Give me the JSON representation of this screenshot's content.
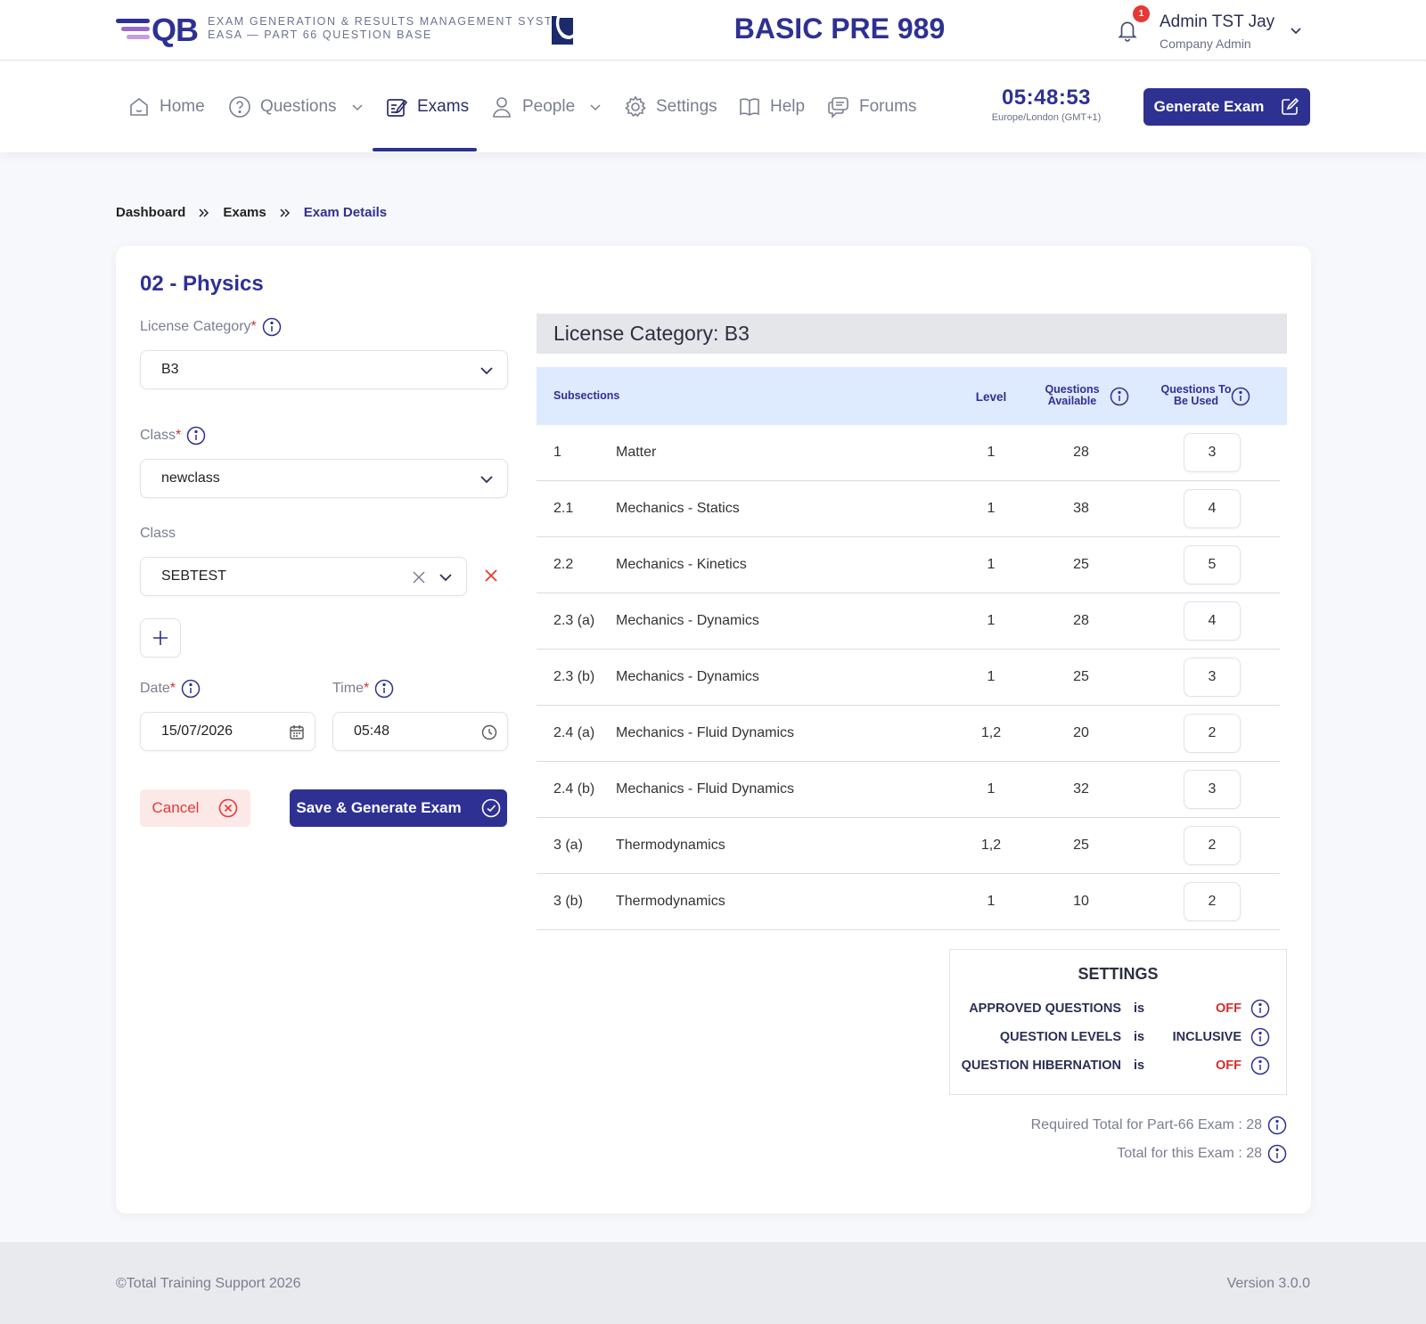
{
  "header": {
    "system_line1": "Exam Generation & Results Management System",
    "system_line2": "EASA — Part 66 Question Base",
    "logo_text": "QB",
    "app_title": "BASIC PRE 989",
    "notifications_count": "1",
    "user_name": "Admin TST Jay",
    "user_role": "Company Admin"
  },
  "nav": {
    "items": [
      {
        "label": "Home",
        "icon": "home-icon"
      },
      {
        "label": "Questions",
        "icon": "question-circle-icon"
      },
      {
        "label": "Exams",
        "icon": "edit-note-icon"
      },
      {
        "label": "People",
        "icon": "person-icon"
      },
      {
        "label": "Settings",
        "icon": "gear-icon"
      },
      {
        "label": "Help",
        "icon": "book-icon"
      },
      {
        "label": "Forums",
        "icon": "chat-icon"
      }
    ],
    "active": "Exams",
    "clock_time": "05:48:53",
    "clock_tz": "Europe/London (GMT+1)",
    "generate_label": "Generate Exam"
  },
  "breadcrumb": [
    "Dashboard",
    "Exams",
    "Exam Details"
  ],
  "form": {
    "title": "02 - Physics",
    "license_label": "License Category",
    "license_value": "B3",
    "class_label_required": "Class",
    "class_value": "newclass",
    "class_label": "Class",
    "class2_value": "SEBTEST",
    "date_label": "Date",
    "date_value": "15/07/2026",
    "time_label": "Time",
    "time_value": "05:48",
    "required_mark": "*",
    "cancel_label": "Cancel",
    "save_label": "Save & Generate Exam"
  },
  "table": {
    "category_header": "License Category: B3",
    "col_subsections": "Subsections",
    "col_level": "Level",
    "col_available": "Questions Available",
    "col_used": "Questions To Be Used",
    "rows": [
      {
        "num": "1",
        "name": "Matter",
        "level": "1",
        "available": "28",
        "used": "3"
      },
      {
        "num": "2.1",
        "name": "Mechanics - Statics",
        "level": "1",
        "available": "38",
        "used": "4"
      },
      {
        "num": "2.2",
        "name": "Mechanics - Kinetics",
        "level": "1",
        "available": "25",
        "used": "5"
      },
      {
        "num": "2.3 (a)",
        "name": "Mechanics - Dynamics",
        "level": "1",
        "available": "28",
        "used": "4"
      },
      {
        "num": "2.3 (b)",
        "name": "Mechanics - Dynamics",
        "level": "1",
        "available": "25",
        "used": "3"
      },
      {
        "num": "2.4 (a)",
        "name": "Mechanics - Fluid Dynamics",
        "level": "1,2",
        "available": "20",
        "used": "2"
      },
      {
        "num": "2.4 (b)",
        "name": "Mechanics - Fluid Dynamics",
        "level": "1",
        "available": "32",
        "used": "3"
      },
      {
        "num": "3 (a)",
        "name": "Thermodynamics",
        "level": "1,2",
        "available": "25",
        "used": "2"
      },
      {
        "num": "3 (b)",
        "name": "Thermodynamics",
        "level": "1",
        "available": "10",
        "used": "2"
      }
    ]
  },
  "settings": {
    "title": "SETTINGS",
    "rows": [
      {
        "key": "APPROVED QUESTIONS",
        "is": "is",
        "value": "OFF",
        "status_color": "#d32f2f"
      },
      {
        "key": "QUESTION LEVELS",
        "is": "is",
        "value": "INCLUSIVE",
        "status_color": "#2b2f55"
      },
      {
        "key": "QUESTION HIBERNATION",
        "is": "is",
        "value": "OFF",
        "status_color": "#d32f2f"
      }
    ]
  },
  "totals": {
    "required": "Required Total for Part-66 Exam : 28",
    "this_exam": "Total for this Exam : 28"
  },
  "footer": {
    "copyright": "©Total Training Support 2026",
    "version": "Version 3.0.0"
  },
  "colors": {
    "brand": "#2e3192",
    "danger": "#d32f2f",
    "header_row": "#deeafd"
  }
}
